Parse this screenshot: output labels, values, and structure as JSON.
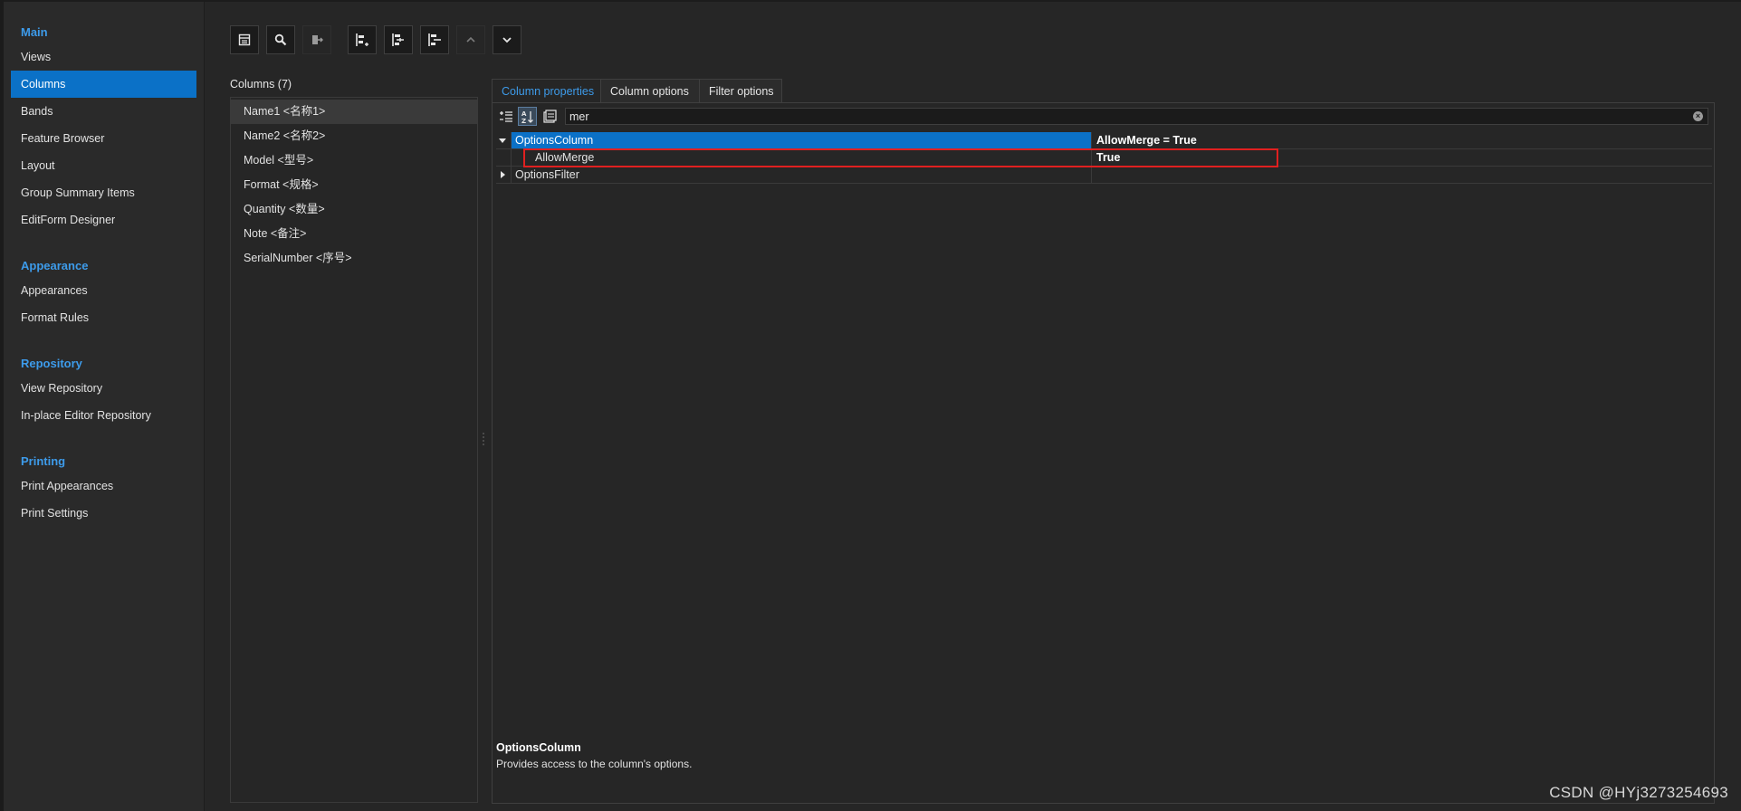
{
  "sidebar": {
    "groups": [
      {
        "header": "Main",
        "items": [
          "Views",
          "Columns",
          "Bands",
          "Feature Browser",
          "Layout",
          "Group Summary Items",
          "EditForm Designer"
        ]
      },
      {
        "header": "Appearance",
        "items": [
          "Appearances",
          "Format Rules"
        ]
      },
      {
        "header": "Repository",
        "items": [
          "View Repository",
          "In-place Editor Repository"
        ]
      },
      {
        "header": "Printing",
        "items": [
          "Print Appearances",
          "Print Settings"
        ]
      }
    ],
    "selected": "Columns"
  },
  "toolbar": {
    "buttons": [
      "form-icon",
      "search-icon",
      "export-icon",
      "add-column-icon",
      "insert-column-icon",
      "remove-column-icon",
      "move-up-icon",
      "move-down-icon"
    ]
  },
  "columns": {
    "label": "Columns (7)",
    "items": [
      "Name1 <名称1>",
      "Name2 <名称2>",
      "Model <型号>",
      "Format <规格>",
      "Quantity <数量>",
      "Note <备注>",
      "SerialNumber <序号>"
    ]
  },
  "tabs": [
    "Column properties",
    "Column options",
    "Filter options"
  ],
  "property_grid": {
    "search_value": "mer",
    "rows": [
      {
        "name": "OptionsColumn",
        "value": "AllowMerge = True"
      },
      {
        "name": "AllowMerge",
        "value": "True"
      },
      {
        "name": "OptionsFilter",
        "value": ""
      }
    ],
    "description_title": "OptionsColumn",
    "description_text": "Provides access to the column's options."
  },
  "watermark": "CSDN @HYj3273254693",
  "colors": {
    "accent": "#0b71c7",
    "header": "#3d9bea",
    "highlight_border": "#e02020"
  }
}
